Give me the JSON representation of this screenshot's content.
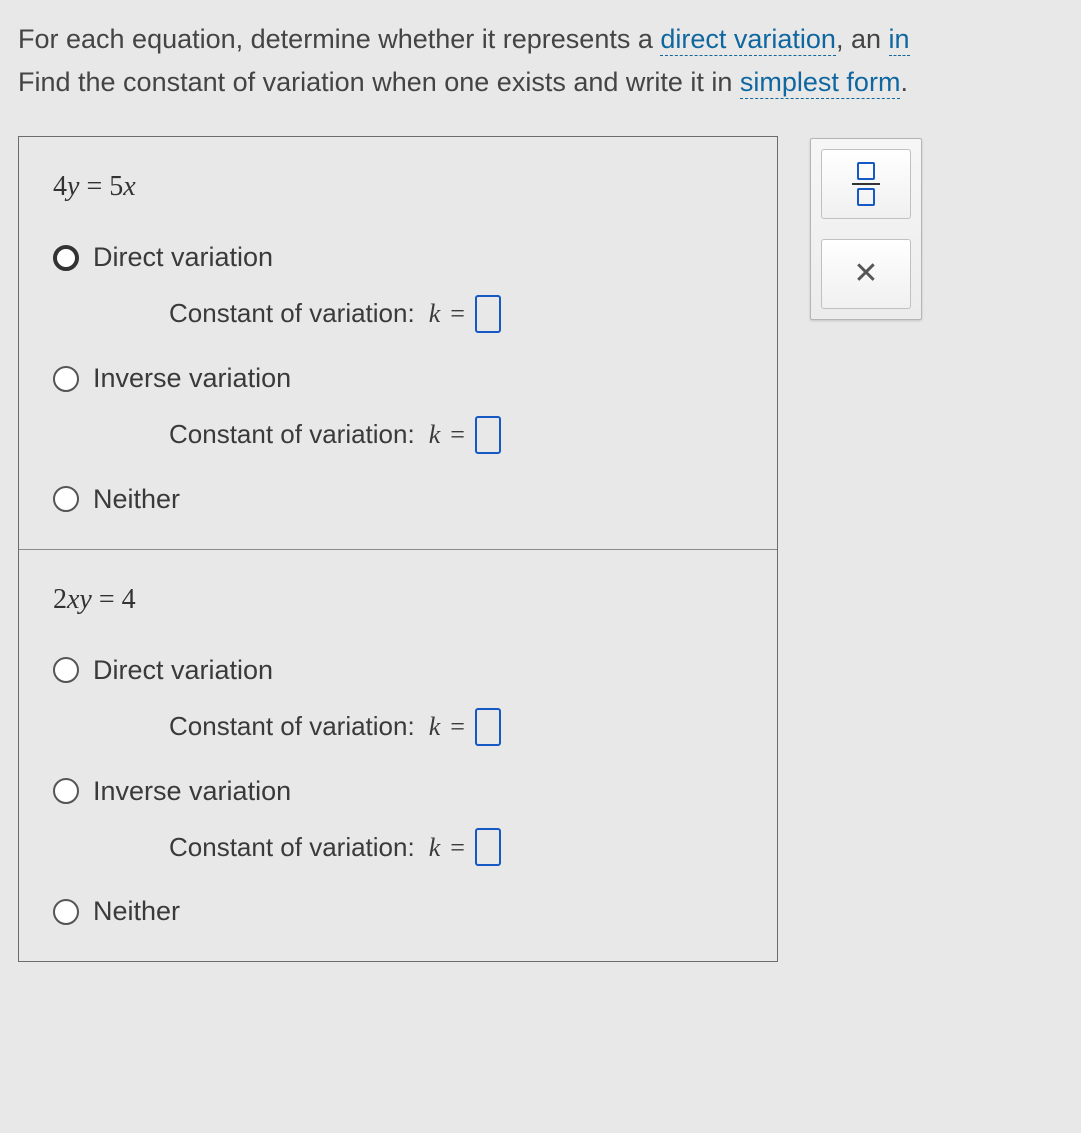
{
  "instructions": {
    "line1_pre": "For each equation, determine whether it represents a ",
    "link1": "direct variation",
    "line1_mid": ", an ",
    "line1_trail": "in",
    "line2_pre": "Find the constant of variation when one exists and write it in ",
    "link2": "simplest form",
    "line2_post": "."
  },
  "questions": [
    {
      "equation_html": "<span class='num'>4</span>y <span class='num'>=</span> <span class='num'>5</span>x",
      "opt_direct": "Direct variation",
      "opt_inverse": "Inverse variation",
      "opt_neither": "Neither",
      "const_label": "Constant of variation:",
      "k": "k",
      "eq": "=",
      "selected": 0
    },
    {
      "equation_html": "<span class='num'>2</span>xy <span class='num'>=</span> <span class='num'>4</span>",
      "opt_direct": "Direct variation",
      "opt_inverse": "Inverse variation",
      "opt_neither": "Neither",
      "const_label": "Constant of variation:",
      "k": "k",
      "eq": "=",
      "selected": -1
    }
  ],
  "tools": {
    "fraction_name": "fraction",
    "close_name": "close"
  }
}
